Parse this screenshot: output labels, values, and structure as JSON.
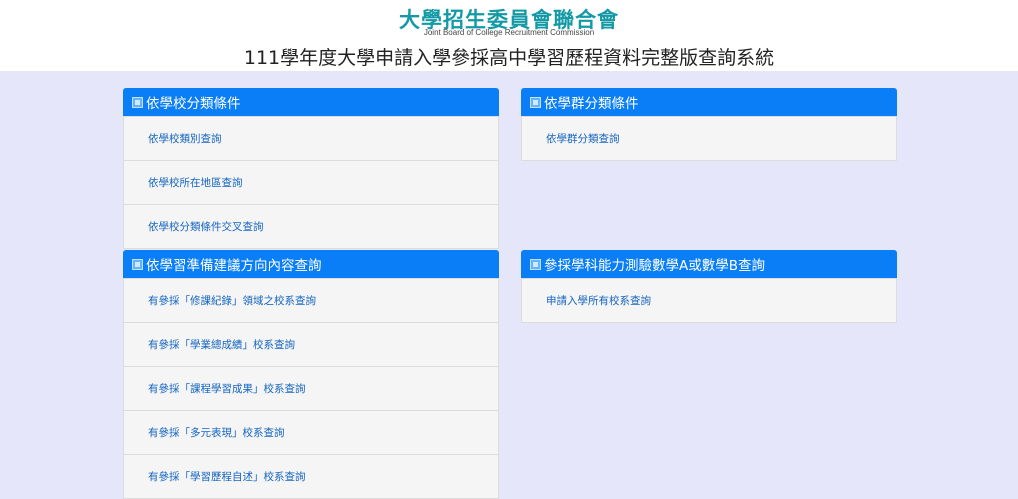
{
  "header": {
    "org_name": "大學招生委員會聯合會",
    "org_name_en": "Joint Board of College Recruitment Commission",
    "system_title": "111學年度大學申請入學參採高中學習歷程資料完整版查詢系統"
  },
  "panels": {
    "school_category": {
      "title": "依學校分類條件",
      "items": [
        "依學校類別查詢",
        "依學校所在地區查詢",
        "依學校分類條件交叉查詢"
      ]
    },
    "group_category": {
      "title": "依學群分類條件",
      "items": [
        "依學群分類查詢"
      ]
    },
    "learning_prep": {
      "title": "依學習準備建議方向內容查詢",
      "items": [
        "有參採「修課紀錄」領域之校系查詢",
        "有參採「學業總成績」校系查詢",
        "有參採「課程學習成果」校系查詢",
        "有參採「多元表現」校系查詢",
        "有參採「學習歷程自述」校系查詢"
      ]
    },
    "math_test": {
      "title": "參採學科能力測驗數學A或數學B查詢",
      "items": [
        "申請入學所有校系查詢"
      ]
    }
  },
  "colors": {
    "page_background": "#e6e6fa",
    "panel_header": "#0a7ef6",
    "link_text": "#1565c0",
    "logo": "#139aa6"
  }
}
